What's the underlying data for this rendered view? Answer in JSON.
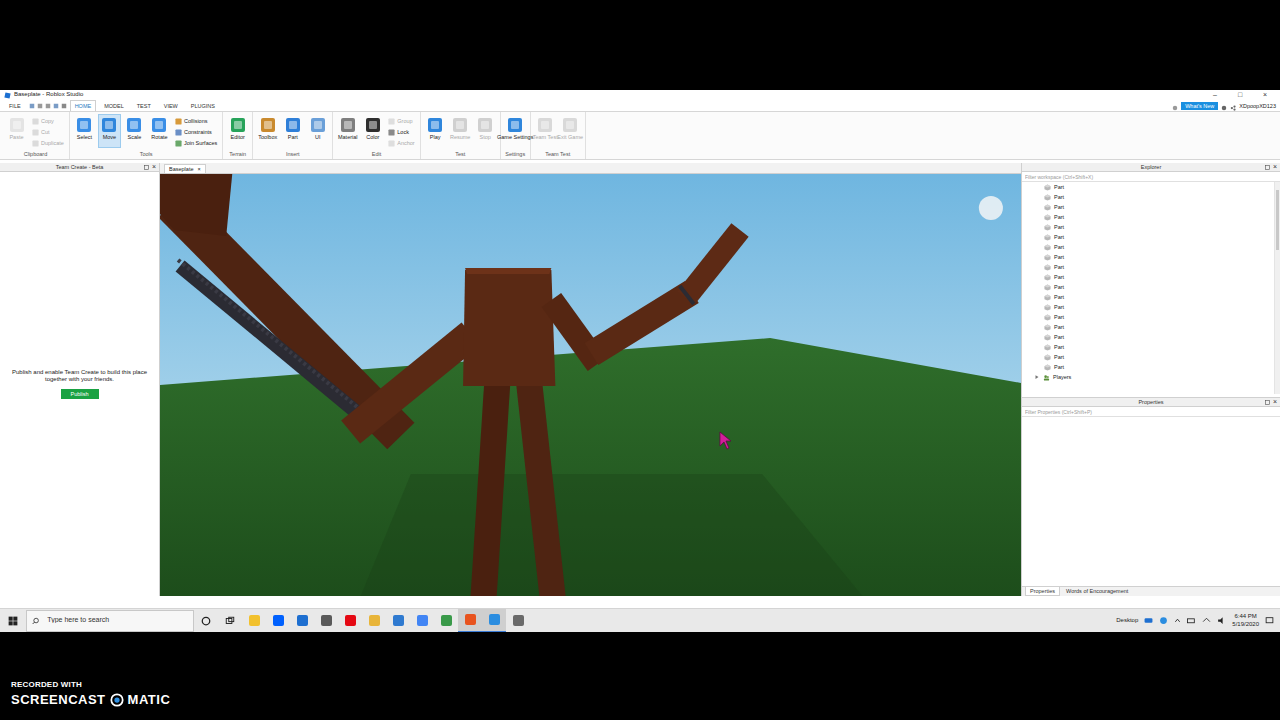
{
  "window": {
    "title": "Baseplate - Roblox Studio",
    "controls": [
      "–",
      "□",
      "×"
    ]
  },
  "menu": {
    "file": "FILE",
    "tabs": [
      {
        "label": "HOME",
        "selected": true
      },
      {
        "label": "MODEL",
        "selected": false
      },
      {
        "label": "TEST",
        "selected": false
      },
      {
        "label": "VIEW",
        "selected": false
      },
      {
        "label": "PLUGINS",
        "selected": false
      }
    ],
    "whats_new": "What's New",
    "user": "XDpoopXD123"
  },
  "ribbon": [
    {
      "label": "Clipboard",
      "items": [
        {
          "label": "Paste",
          "kind": "large",
          "selected": false,
          "disabled": true
        },
        {
          "label": "Copy",
          "kind": "small",
          "selected": false,
          "disabled": true
        },
        {
          "label": "Cut",
          "kind": "small",
          "selected": false,
          "disabled": true
        },
        {
          "label": "Duplicate",
          "kind": "small",
          "selected": false,
          "disabled": true
        }
      ]
    },
    {
      "label": "Tools",
      "items": [
        {
          "label": "Select",
          "kind": "large",
          "selected": false,
          "disabled": false
        },
        {
          "label": "Move",
          "kind": "large",
          "selected": true,
          "disabled": false
        },
        {
          "label": "Scale",
          "kind": "large",
          "selected": false,
          "disabled": false
        },
        {
          "label": "Rotate",
          "kind": "large",
          "selected": false,
          "disabled": false
        },
        {
          "label": "Collisions",
          "kind": "small",
          "selected": false,
          "disabled": false
        },
        {
          "label": "Constraints",
          "kind": "small",
          "selected": false,
          "disabled": false
        },
        {
          "label": "Join Surfaces",
          "kind": "small",
          "selected": false,
          "disabled": false
        }
      ]
    },
    {
      "label": "Terrain",
      "items": [
        {
          "label": "Editor",
          "kind": "large",
          "selected": false,
          "disabled": false
        }
      ]
    },
    {
      "label": "Insert",
      "items": [
        {
          "label": "Toolbox",
          "kind": "large",
          "selected": false,
          "disabled": false
        },
        {
          "label": "Part",
          "kind": "large",
          "selected": false,
          "disabled": false
        },
        {
          "label": "UI",
          "kind": "large",
          "selected": false,
          "disabled": false
        }
      ]
    },
    {
      "label": "Edit",
      "items": [
        {
          "label": "Material",
          "kind": "large",
          "selected": false,
          "disabled": false
        },
        {
          "label": "Color",
          "kind": "large",
          "selected": false,
          "disabled": false
        },
        {
          "label": "Group",
          "kind": "small",
          "selected": false,
          "disabled": true
        },
        {
          "label": "Lock",
          "kind": "small",
          "selected": false,
          "disabled": false
        },
        {
          "label": "Anchor",
          "kind": "small",
          "selected": false,
          "disabled": true
        }
      ]
    },
    {
      "label": "Test",
      "items": [
        {
          "label": "Play",
          "kind": "large",
          "selected": false,
          "disabled": false
        },
        {
          "label": "Resume",
          "kind": "large",
          "selected": false,
          "disabled": true
        },
        {
          "label": "Stop",
          "kind": "large",
          "selected": false,
          "disabled": true
        }
      ]
    },
    {
      "label": "Settings",
      "items": [
        {
          "label": "Game Settings",
          "kind": "large",
          "selected": false,
          "disabled": false
        }
      ]
    },
    {
      "label": "Team Test",
      "items": [
        {
          "label": "Team Test",
          "kind": "large",
          "selected": false,
          "disabled": true
        },
        {
          "label": "Exit Game",
          "kind": "large",
          "selected": false,
          "disabled": true
        }
      ]
    }
  ],
  "left_panel": {
    "title": "Team Create - Beta",
    "close": "×",
    "message": "Publish and enable Team Create to build this place together with your friends.",
    "button": "Publish"
  },
  "document_tab": {
    "label": "Baseplate",
    "close": "×"
  },
  "explorer": {
    "title": "Explorer",
    "close": "×",
    "filter_placeholder": "Filter workspace (Ctrl+Shift+X)",
    "items": [
      {
        "label": "Part",
        "kind": "part"
      },
      {
        "label": "Part",
        "kind": "part"
      },
      {
        "label": "Part",
        "kind": "part"
      },
      {
        "label": "Part",
        "kind": "part"
      },
      {
        "label": "Part",
        "kind": "part"
      },
      {
        "label": "Part",
        "kind": "part"
      },
      {
        "label": "Part",
        "kind": "part"
      },
      {
        "label": "Part",
        "kind": "part"
      },
      {
        "label": "Part",
        "kind": "part"
      },
      {
        "label": "Part",
        "kind": "part"
      },
      {
        "label": "Part",
        "kind": "part"
      },
      {
        "label": "Part",
        "kind": "part"
      },
      {
        "label": "Part",
        "kind": "part"
      },
      {
        "label": "Part",
        "kind": "part"
      },
      {
        "label": "Part",
        "kind": "part"
      },
      {
        "label": "Part",
        "kind": "part"
      },
      {
        "label": "Part",
        "kind": "part"
      },
      {
        "label": "Part",
        "kind": "part"
      },
      {
        "label": "Part",
        "kind": "part"
      },
      {
        "label": "Players",
        "kind": "service"
      }
    ]
  },
  "properties": {
    "title": "Properties",
    "close": "×",
    "filter_placeholder": "Filter Properties (Ctrl+Shift+P)"
  },
  "bottom_tabs": [
    {
      "label": "Properties",
      "selected": true
    },
    {
      "label": "Words of Encouragement",
      "selected": false
    }
  ],
  "taskbar": {
    "search_placeholder": "Type here to search",
    "apps": [
      {
        "color": "#f2c12e",
        "active": false
      },
      {
        "color": "#0061fe",
        "active": false
      },
      {
        "color": "#1e6fd0",
        "active": false
      },
      {
        "color": "#5a5a5a",
        "active": false
      },
      {
        "color": "#e50914",
        "active": false
      },
      {
        "color": "#e8b53a",
        "active": false
      },
      {
        "color": "#2f7ad0",
        "active": false
      },
      {
        "color": "#4285f4",
        "active": false
      },
      {
        "color": "#3a9a4a",
        "active": false
      },
      {
        "color": "#e8531e",
        "active": true
      },
      {
        "color": "#2b8de0",
        "active": true
      },
      {
        "color": "#6a6a6a",
        "active": false
      }
    ],
    "desktop": "Desktop",
    "time": "6:44 PM",
    "date": "5/19/2020"
  },
  "recording": {
    "line1": "RECORDED WITH",
    "brand_left": "SCREENCAST",
    "brand_right": "MATIC"
  }
}
